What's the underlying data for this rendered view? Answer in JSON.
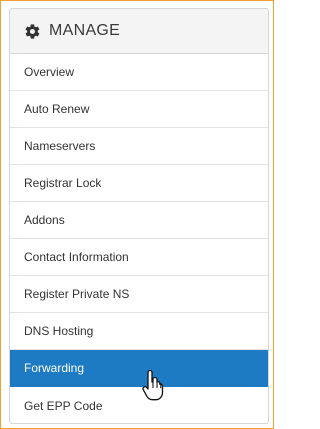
{
  "header": {
    "icon": "gear-icon",
    "title": "MANAGE"
  },
  "menu": {
    "items": [
      {
        "label": "Overview",
        "active": false
      },
      {
        "label": "Auto Renew",
        "active": false
      },
      {
        "label": "Nameservers",
        "active": false
      },
      {
        "label": "Registrar Lock",
        "active": false
      },
      {
        "label": "Addons",
        "active": false
      },
      {
        "label": "Contact Information",
        "active": false
      },
      {
        "label": "Register Private NS",
        "active": false
      },
      {
        "label": "DNS Hosting",
        "active": false
      },
      {
        "label": "Forwarding",
        "active": true
      },
      {
        "label": "Get EPP Code",
        "active": false
      }
    ]
  },
  "colors": {
    "frame_border": "#f0a030",
    "active_bg": "#1c7bc2",
    "header_bg": "#f4f4f4"
  },
  "cursor": {
    "icon": "hand-pointer-icon"
  }
}
